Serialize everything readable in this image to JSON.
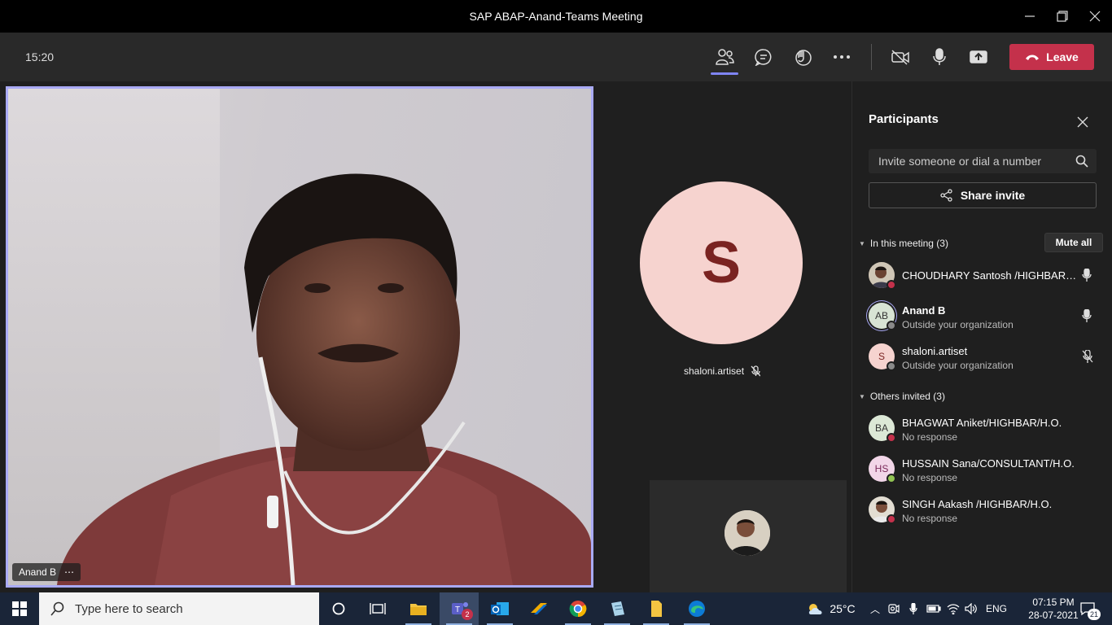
{
  "window": {
    "title": "SAP ABAP-Anand-Teams Meeting"
  },
  "meeting": {
    "timer": "15:20",
    "leave_label": "Leave"
  },
  "stage": {
    "main_video_name": "Anand B",
    "tile_initial": "S",
    "tile_name": "shaloni.artiset"
  },
  "participants": {
    "title": "Participants",
    "search_placeholder": "Invite someone or dial a number",
    "share_label": "Share invite",
    "in_meeting_label": "In this meeting (3)",
    "mute_all_label": "Mute all",
    "in_meeting": [
      {
        "name": "CHOUDHARY Santosh /HIGHBAR/H.O.",
        "sub": "",
        "initials": "",
        "status": "busy",
        "mic": "on"
      },
      {
        "name": "Anand B",
        "sub": "Outside your organization",
        "initials": "AB",
        "status": "unknown",
        "mic": "on"
      },
      {
        "name": "shaloni.artiset",
        "sub": "Outside your organization",
        "initials": "S",
        "status": "unknown",
        "mic": "muted"
      }
    ],
    "others_label": "Others invited (3)",
    "others": [
      {
        "name": "BHAGWAT Aniket/HIGHBAR/H.O.",
        "sub": "No response",
        "initials": "BA",
        "status": "busy"
      },
      {
        "name": "HUSSAIN Sana/CONSULTANT/H.O.",
        "sub": "No response",
        "initials": "HS",
        "status": "available"
      },
      {
        "name": "SINGH Aakash /HIGHBAR/H.O.",
        "sub": "No response",
        "initials": "",
        "status": "busy"
      }
    ]
  },
  "taskbar": {
    "search_placeholder": "Type here to search",
    "teams_badge": "2",
    "weather": "25°C",
    "language": "ENG",
    "time": "07:15 PM",
    "date": "28-07-2021",
    "notifications": "21"
  },
  "colors": {
    "leave": "#c4314b",
    "accent": "#7f85f5",
    "busy": "#c4314b",
    "available": "#92c353"
  }
}
